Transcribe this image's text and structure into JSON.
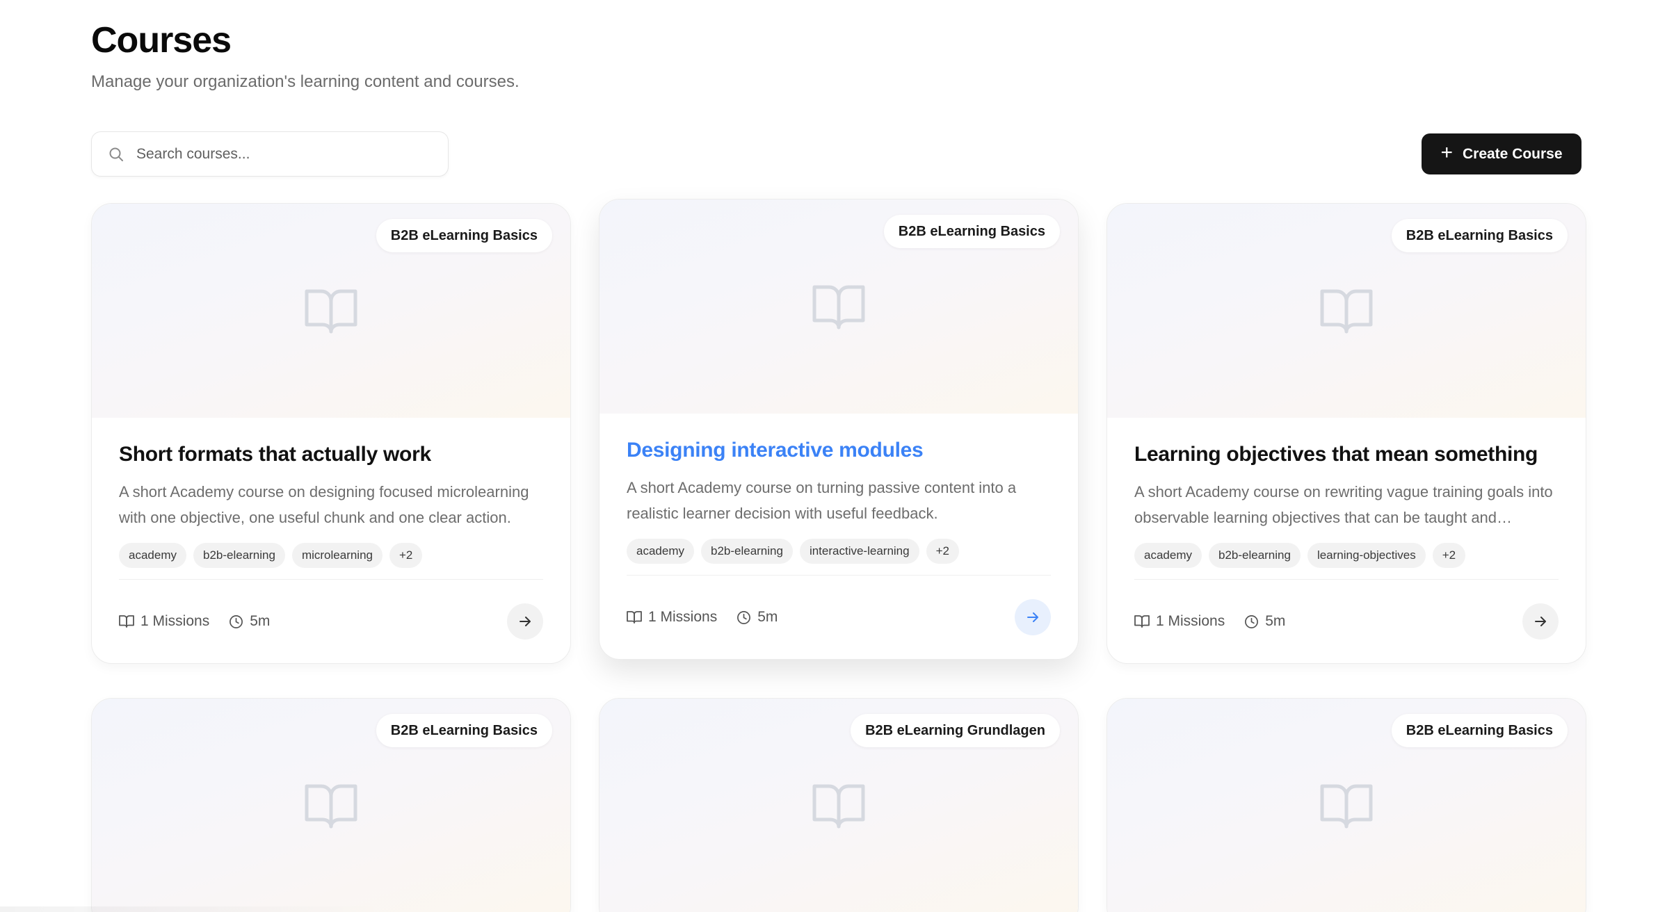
{
  "header": {
    "title": "Courses",
    "subtitle": "Manage your organization's learning content and courses."
  },
  "search": {
    "placeholder": "Search courses...",
    "icon": "search-icon"
  },
  "create_button": {
    "label": "Create Course",
    "icon": "plus-icon"
  },
  "colors": {
    "accent": "#3b82f6",
    "primary_button": "#151515"
  },
  "courses": [
    {
      "badge": "B2B eLearning Basics",
      "title": "Short formats that actually work",
      "description": "A short Academy course on designing focused microlearning with one objective, one useful chunk and one clear action.",
      "tags": [
        "academy",
        "b2b-elearning",
        "microlearning",
        "+2"
      ],
      "missions": "1 Missions",
      "duration": "5m"
    },
    {
      "badge": "B2B eLearning Basics",
      "title": "Designing interactive modules",
      "description": "A short Academy course on turning passive content into a realistic learner decision with useful feedback.",
      "tags": [
        "academy",
        "b2b-elearning",
        "interactive-learning",
        "+2"
      ],
      "missions": "1 Missions",
      "duration": "5m"
    },
    {
      "badge": "B2B eLearning Basics",
      "title": "Learning objectives that mean something",
      "description": "A short Academy course on rewriting vague training goals into observable learning objectives that can be taught and assessed.",
      "tags": [
        "academy",
        "b2b-elearning",
        "learning-objectives",
        "+2"
      ],
      "missions": "1 Missions",
      "duration": "5m"
    },
    {
      "badge": "B2B eLearning Basics"
    },
    {
      "badge": "B2B eLearning Grundlagen"
    },
    {
      "badge": "B2B eLearning Basics"
    }
  ]
}
